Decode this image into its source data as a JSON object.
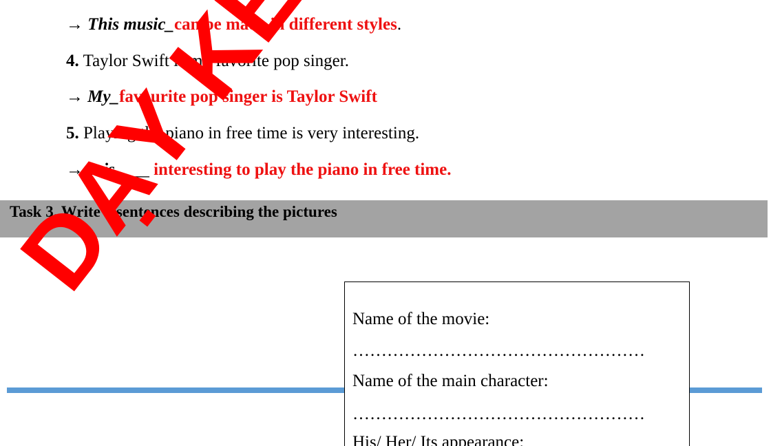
{
  "exercise": {
    "line3_answer": {
      "arrow": "→",
      "prompt": "This music_",
      "answer": "can be made in different styles",
      "end": "."
    },
    "item4": {
      "number": "4.",
      "text": "Taylor Swift is my favorite pop singer."
    },
    "item4_answer": {
      "arrow": "→",
      "prompt": "My_",
      "answer": "favourite pop singer is Taylor Swift"
    },
    "item5": {
      "number": "5.",
      "text": "Playing the piano in free time is very interesting."
    },
    "item5_answer": {
      "arrow": "→",
      "prompt": "It is",
      "blank": "____",
      "answer": "interesting to play the piano in free time."
    }
  },
  "task3": {
    "title": "Task 3. Write 5 sentences describing the pictures"
  },
  "info_box": {
    "movie_label": "Name of the movie:",
    "movie_dots": "……………………………………………",
    "character_label": "Name of the main character:",
    "character_dots": "……………………………………………",
    "appearance_label": "His/ Her/ Its appearance:"
  },
  "watermark": {
    "text": "DẠY KÈM QUY NHƠN"
  },
  "colors": {
    "answer_red": "#ee1111",
    "task_bar_gray": "#a3a3a3",
    "rule_blue": "#5b9bd5",
    "watermark_red": "#ff0000"
  }
}
